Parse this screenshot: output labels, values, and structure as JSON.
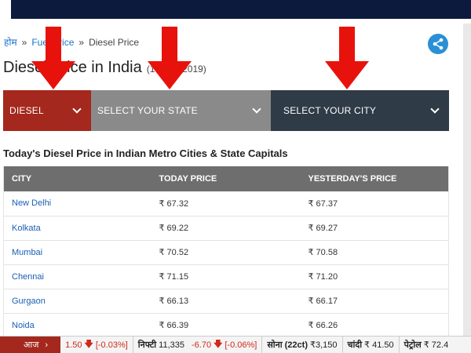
{
  "breadcrumb": {
    "home": "होम",
    "sep": "»",
    "parent": "Fuel Price",
    "current": "Diesel Price"
  },
  "title": {
    "text": "Diesel Price in India",
    "date": "(14 Dec 2019)"
  },
  "selectors": {
    "fuel": "DIESEL",
    "state": "SELECT YOUR STATE",
    "city": "SELECT YOUR CITY"
  },
  "section_title": "Today's Diesel Price in Indian Metro Cities & State Capitals",
  "table": {
    "headers": [
      "CITY",
      "TODAY PRICE",
      "YESTERDAY'S PRICE"
    ],
    "rows": [
      [
        "New Delhi",
        "₹ 67.32",
        "₹ 67.37"
      ],
      [
        "Kolkata",
        "₹ 69.22",
        "₹ 69.27"
      ],
      [
        "Mumbai",
        "₹ 70.52",
        "₹ 70.58"
      ],
      [
        "Chennai",
        "₹ 71.15",
        "₹ 71.20"
      ],
      [
        "Gurgaon",
        "₹ 66.13",
        "₹ 66.17"
      ],
      [
        "Noida",
        "₹ 66.39",
        "₹ 66.26"
      ]
    ]
  },
  "ticker": {
    "today_label": "आज",
    "item1_change": "1.50",
    "item1_pct": "[-0.03%]",
    "nifty_label": "निफ्टी",
    "nifty_value": "11,335",
    "nifty_change": "-6.70",
    "nifty_pct": "[-0.06%]",
    "gold_label": "सोना (22ct)",
    "gold_value": "₹3,150",
    "silver_label": "चांदी",
    "silver_value": "₹ 41.50",
    "petrol_label": "पेट्रोल",
    "petrol_value": "₹ 72.4"
  },
  "colors": {
    "accent_red": "#a4281d",
    "state_grey": "#8a8a8a",
    "city_dark": "#2f3b46",
    "link_blue": "#1a5fb4",
    "arrow_red": "#e8120c"
  }
}
